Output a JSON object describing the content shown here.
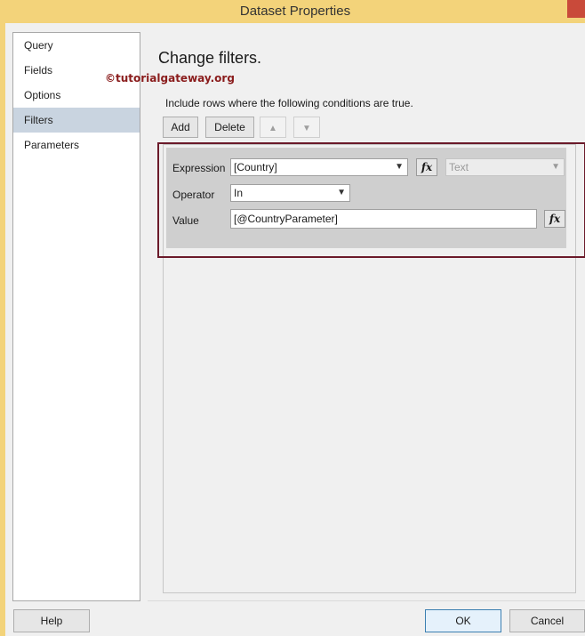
{
  "window": {
    "title": "Dataset Properties"
  },
  "nav": {
    "items": [
      {
        "label": "Query"
      },
      {
        "label": "Fields"
      },
      {
        "label": "Options"
      },
      {
        "label": "Filters"
      },
      {
        "label": "Parameters"
      }
    ],
    "selected": "Filters"
  },
  "watermark": "©tutorialgateway.org",
  "main": {
    "heading": "Change filters.",
    "subtext": "Include rows where the following conditions are true."
  },
  "toolbar": {
    "add_label": "Add",
    "delete_label": "Delete",
    "up_icon": "up-arrow-icon",
    "down_icon": "down-arrow-icon"
  },
  "filter": {
    "expression_label": "Expression",
    "expression_value": "[Country]",
    "type_value": "Text",
    "operator_label": "Operator",
    "operator_value": "In",
    "value_label": "Value",
    "value_value": "[@CountryParameter]",
    "fx_label": "fx"
  },
  "footer": {
    "help_label": "Help",
    "ok_label": "OK",
    "cancel_label": "Cancel"
  },
  "colors": {
    "title_bar": "#f3d37a",
    "selection": "#c9d4e0",
    "highlight_border": "#6b1a2a",
    "watermark": "#8a1c1c"
  }
}
